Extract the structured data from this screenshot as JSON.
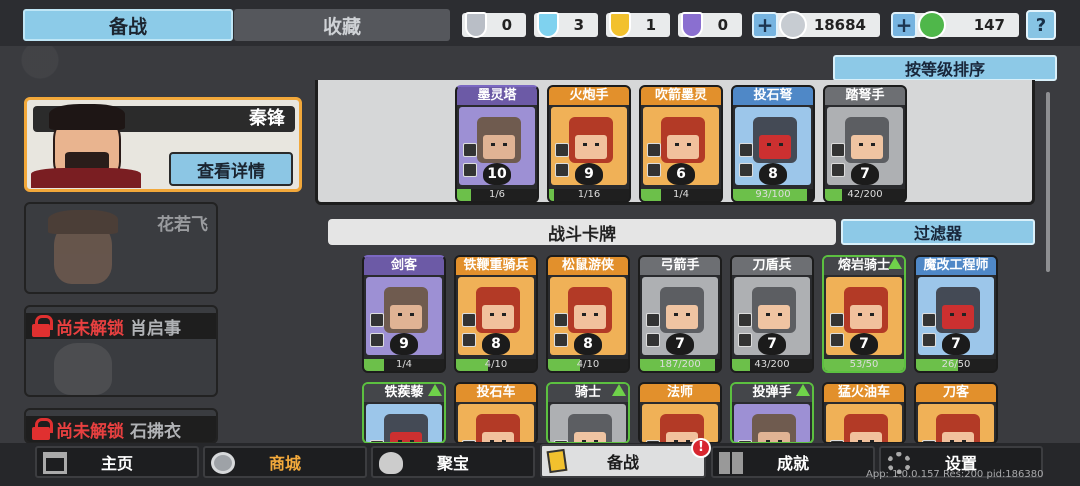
{
  "tabs": {
    "active": "备战",
    "inactive": "收藏"
  },
  "resources": {
    "silver_shield": "0",
    "crystal_shield": "3",
    "gold_shield": "1",
    "purple_shield": "0",
    "coins": "18684",
    "gems": "147"
  },
  "help_label": "?",
  "plus_label": "+",
  "heroes": {
    "selected": {
      "name": "秦锋",
      "detail_button": "查看详情"
    },
    "second": {
      "name": "花若飞"
    },
    "third": {
      "lock_text": "尚未解锁",
      "name": "肖启事"
    },
    "fourth": {
      "lock_text": "尚未解锁",
      "name": "石拂衣"
    }
  },
  "sort_button": "按等级排序",
  "battle_cards_title": "战斗卡牌",
  "filter_button": "过滤器",
  "deck": [
    {
      "name": "墨灵塔",
      "level": "10",
      "progress": "1/6",
      "fill": 0.17,
      "color": "purple"
    },
    {
      "name": "火炮手",
      "level": "9",
      "progress": "1/16",
      "fill": 0.06,
      "color": "orange"
    },
    {
      "name": "吹箭墨灵",
      "level": "6",
      "progress": "1/4",
      "fill": 0.25,
      "color": "orange"
    },
    {
      "name": "投石弩",
      "level": "8",
      "progress": "93/100",
      "fill": 0.93,
      "color": "blue"
    },
    {
      "name": "踏弩手",
      "level": "7",
      "progress": "42/200",
      "fill": 0.21,
      "color": "gray"
    }
  ],
  "cards_row1": [
    {
      "name": "剑客",
      "level": "9",
      "progress": "1/4",
      "fill": 0.25,
      "color": "purple"
    },
    {
      "name": "铁鞭重骑兵",
      "level": "8",
      "progress": "4/10",
      "fill": 0.4,
      "color": "orange"
    },
    {
      "name": "松鼠游侠",
      "level": "8",
      "progress": "4/10",
      "fill": 0.4,
      "color": "orange"
    },
    {
      "name": "弓箭手",
      "level": "7",
      "progress": "187/200",
      "fill": 0.94,
      "color": "gray"
    },
    {
      "name": "刀盾兵",
      "level": "7",
      "progress": "43/200",
      "fill": 0.22,
      "color": "gray"
    },
    {
      "name": "熔岩骑士",
      "level": "7",
      "progress": "53/50",
      "fill": 1.0,
      "color": "orange",
      "upgrade": true
    },
    {
      "name": "魔改工程师",
      "level": "7",
      "progress": "26/50",
      "fill": 0.52,
      "color": "blue"
    }
  ],
  "cards_row2": [
    {
      "name": "铁蒺藜",
      "color": "blue",
      "upgrade": true
    },
    {
      "name": "投石车",
      "color": "orange"
    },
    {
      "name": "骑士",
      "color": "gray",
      "upgrade": true
    },
    {
      "name": "法师",
      "color": "orange"
    },
    {
      "name": "投弹手",
      "color": "purple",
      "upgrade": true
    },
    {
      "name": "猛火油车",
      "color": "orange"
    },
    {
      "name": "刀客",
      "color": "orange"
    }
  ],
  "nav": {
    "home": "主页",
    "shop": "商城",
    "treasure": "聚宝",
    "prepare": "备战",
    "achievements": "成就",
    "settings": "设置",
    "badge": "!"
  },
  "version_text": "App: 1.0.0.157 Res:200 pid:186380"
}
